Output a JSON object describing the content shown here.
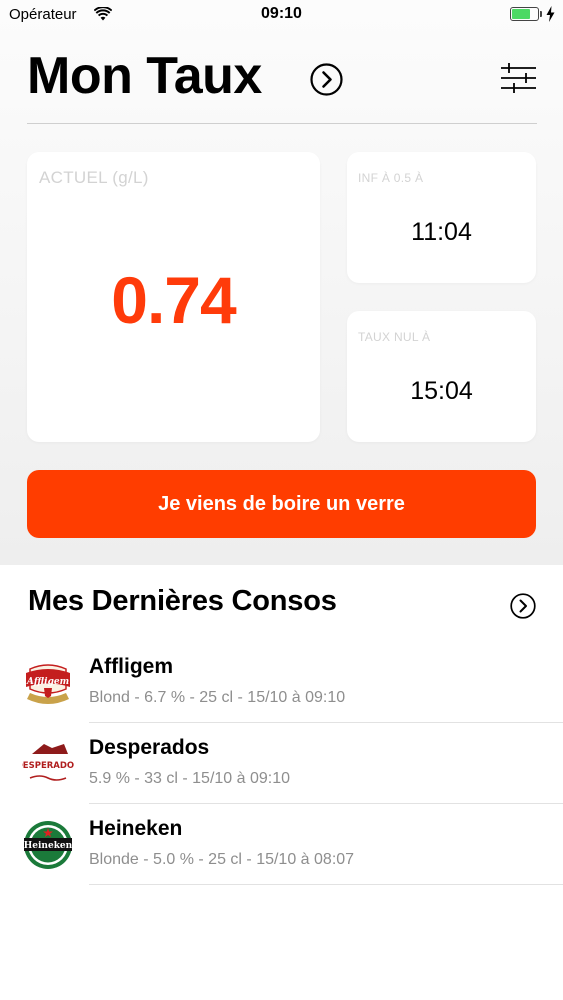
{
  "status_bar": {
    "carrier": "Opérateur",
    "time": "09:10",
    "battery_level": 0.75,
    "battery_color": "#4cd964"
  },
  "header": {
    "title": "Mon Taux",
    "chevron_icon": "chevron-right-circle-icon",
    "settings_icon": "sliders-icon"
  },
  "current_card": {
    "label": "ACTUEL (g/L)",
    "value": "0.74",
    "value_color": "#ff3b0a"
  },
  "below_limit_card": {
    "label": "INF À 0.5 À",
    "value": "11:04"
  },
  "zero_card": {
    "label": "TAUX NUL À",
    "value": "15:04"
  },
  "action_button": {
    "label": "Je viens de boire un verre",
    "color": "#ff3d00"
  },
  "recent": {
    "title": "Mes Dernières Consos",
    "items": [
      {
        "name": "Affligem",
        "details": "Blond - 6.7 % - 25 cl - 15/10 à 09:10",
        "logo_text": "Affligem",
        "logo_icon": "affligem-logo"
      },
      {
        "name": "Desperados",
        "details": "5.9 % - 33 cl - 15/10 à 09:10",
        "logo_text": "DESPERADOS",
        "logo_icon": "desperados-logo"
      },
      {
        "name": "Heineken",
        "details": "Blonde - 5.0 % - 25 cl - 15/10 à 08:07",
        "logo_text": "Heineken",
        "logo_icon": "heineken-logo"
      }
    ]
  }
}
